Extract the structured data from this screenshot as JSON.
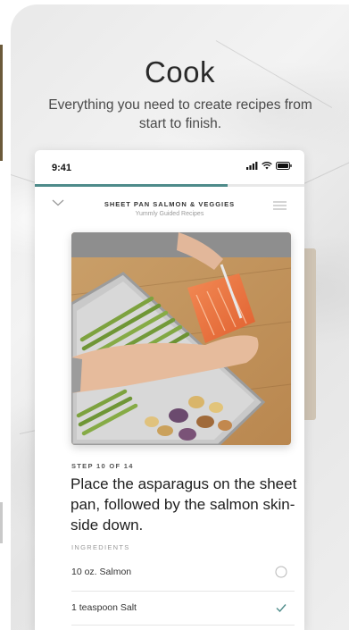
{
  "promo": {
    "headline": "Cook",
    "subline": "Everything you need to create recipes from start to finish."
  },
  "status_bar": {
    "time": "9:41",
    "icons": [
      "signal-icon",
      "wifi-icon",
      "battery-icon"
    ]
  },
  "progress": {
    "current_step": 10,
    "total_steps": 14
  },
  "recipe_nav": {
    "title": "SHEET PAN SALMON & VEGGIES",
    "subtitle": "Yummly Guided Recipes",
    "icons": [
      "chevron-down-icon",
      "list-menu-icon"
    ]
  },
  "step": {
    "label": "STEP 10 OF 14",
    "instruction": "Place the asparagus on the sheet pan, followed by the salmon skin-side down."
  },
  "ingredients": {
    "label": "INGREDIENTS",
    "items": [
      {
        "name": "10 oz. Salmon",
        "checked": false
      },
      {
        "name": "1 teaspoon Salt",
        "checked": true
      }
    ]
  },
  "colors": {
    "accent": "#4e8b8a",
    "text": "#1e1e1e"
  }
}
